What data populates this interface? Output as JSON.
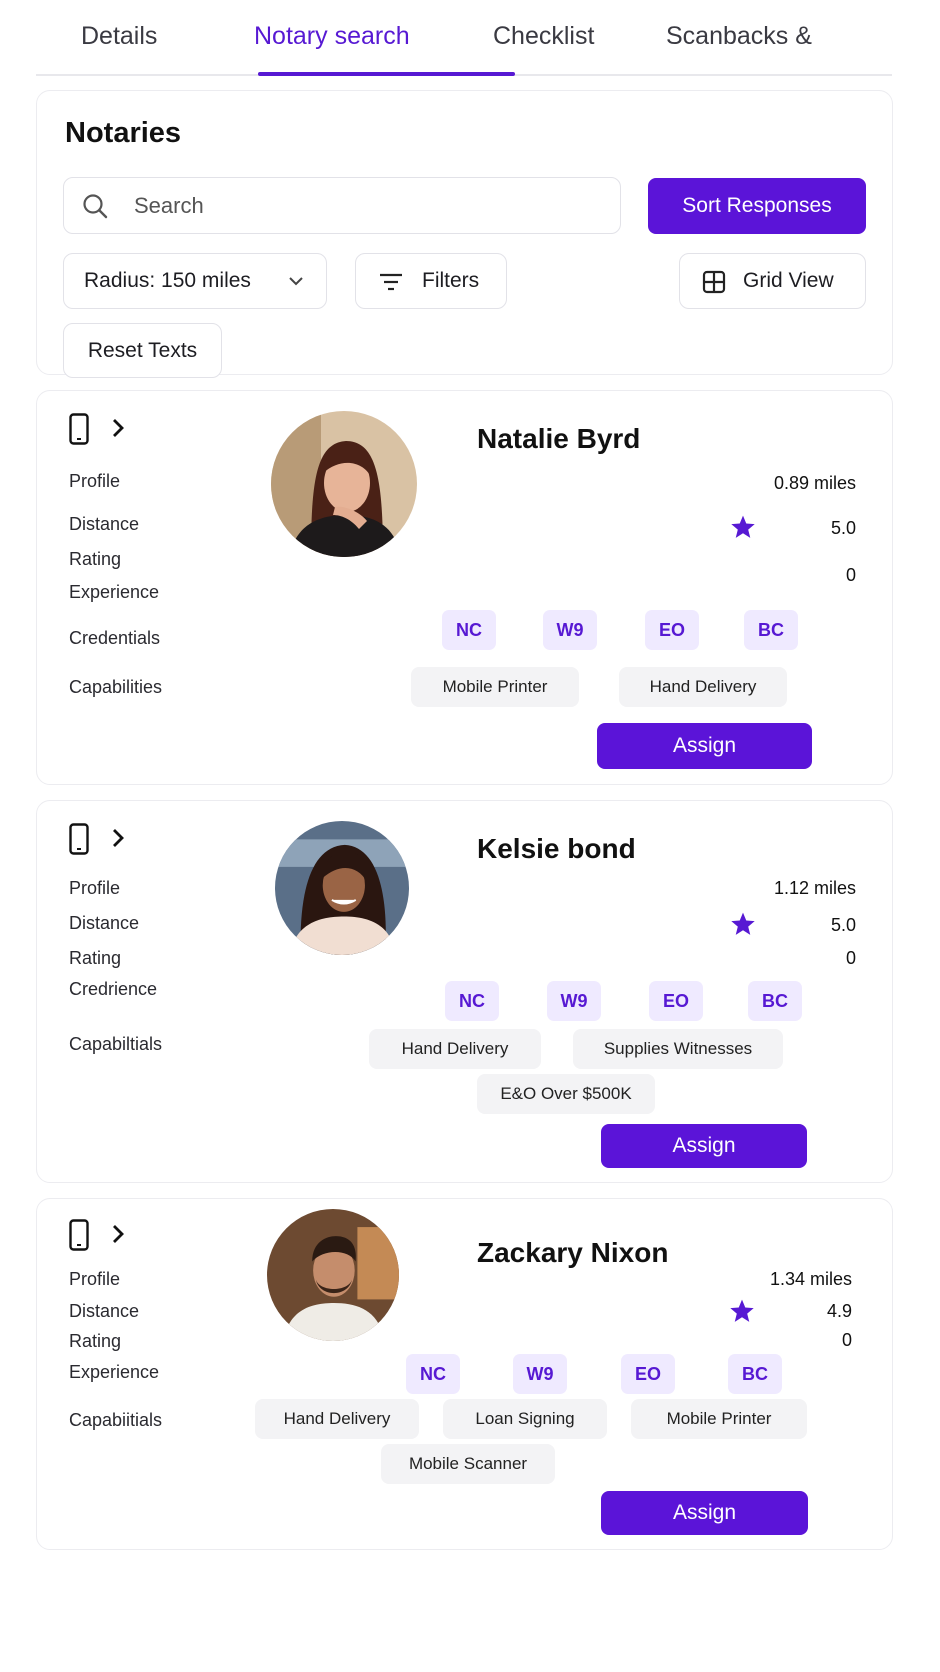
{
  "tabs": [
    {
      "label": "Details"
    },
    {
      "label": "Notary search"
    },
    {
      "label": "Checklist"
    },
    {
      "label": "Scanbacks &"
    }
  ],
  "active_tab": "Notary search",
  "search_panel": {
    "title": "Notaries",
    "search_placeholder": "Search",
    "sort_label": "Sort Responses",
    "radius_label": "Radius: 150 miles",
    "filters_label": "Filters",
    "grid_view_label": "Grid View",
    "reset_label": "Reset Texts"
  },
  "colors": {
    "accent": "#5b14d8",
    "badge_bg": "#efeaff",
    "chip_bg": "#f3f3f5"
  },
  "icons": [
    "search-icon",
    "chevron-down-icon",
    "filter-icon",
    "grid-icon",
    "phone-icon",
    "chevron-right-icon",
    "star-icon"
  ],
  "notaries": [
    {
      "name": "Natalie Byrd",
      "labels": [
        "Profile",
        "Distance",
        "Rating",
        "Experience",
        "Credentials",
        "Capabilities"
      ],
      "distance": "0.89 miles",
      "rating": "5.0",
      "experience": "0",
      "credentials": [
        "NC",
        "W9",
        "EO",
        "BC"
      ],
      "capabilities": [
        "Mobile Printer",
        "Hand Delivery"
      ],
      "assign_label": "Assign"
    },
    {
      "name": "Kelsie bond",
      "labels": [
        "Profile",
        "Distance",
        "Rating",
        "Credrience",
        "Capabiltials"
      ],
      "distance": "1.12 miles",
      "rating": "5.0",
      "experience": "0",
      "credentials": [
        "NC",
        "W9",
        "EO",
        "BC"
      ],
      "capabilities": [
        "Hand Delivery",
        "Supplies Witnesses",
        "E&O Over $500K"
      ],
      "assign_label": "Assign"
    },
    {
      "name": "Zackary Nixon",
      "labels": [
        "Profile",
        "Distance",
        "Rating",
        "Experience",
        "Capabiitials"
      ],
      "distance": "1.34 miles",
      "rating": "4.9",
      "experience": "0",
      "credentials": [
        "NC",
        "W9",
        "EO",
        "BC"
      ],
      "capabilities": [
        "Hand Delivery",
        "Loan Signing",
        "Mobile Printer",
        "Mobile Scanner"
      ],
      "assign_label": "Assign"
    }
  ]
}
